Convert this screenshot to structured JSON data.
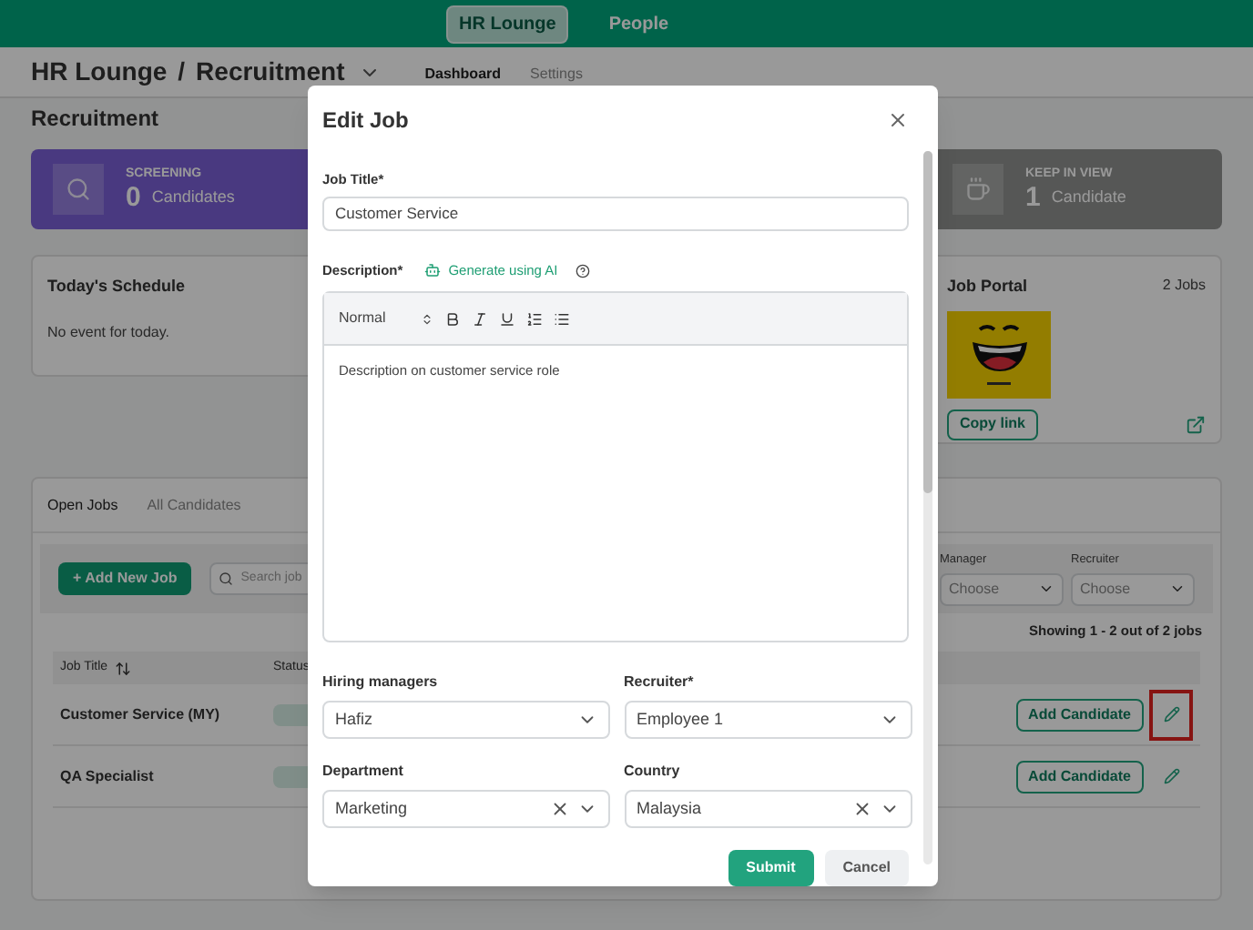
{
  "top_nav": [
    {
      "label": "HR Lounge",
      "selected": true
    },
    {
      "label": "People",
      "selected": false
    }
  ],
  "breadcrumb": {
    "parent": "HR Lounge",
    "separator": "/",
    "current": "Recruitment"
  },
  "page_tabs": [
    {
      "label": "Dashboard",
      "selected": true
    },
    {
      "label": "Settings",
      "selected": false
    }
  ],
  "page_title": "Recruitment",
  "stat_cards": [
    {
      "kind": "screening",
      "label": "SCREENING",
      "count": "0",
      "unit": "Candidates"
    },
    {
      "kind": "keep",
      "label": "KEEP IN VIEW",
      "count": "1",
      "unit": "Candidate"
    }
  ],
  "schedule": {
    "title": "Today's Schedule",
    "message": "No event for today."
  },
  "job_portal": {
    "title": "Job Portal",
    "count": "2 Jobs",
    "button": "Copy link"
  },
  "jobs_panel": {
    "tabs": [
      {
        "label": "Open Jobs",
        "selected": true
      },
      {
        "label": "All Candidates",
        "selected": false
      }
    ],
    "add_button": "+ Add New Job",
    "search": {
      "placeholder": "Search job"
    },
    "filters": [
      {
        "label": "Manager",
        "placeholder": "Choose"
      },
      {
        "label": "Recruiter",
        "placeholder": "Choose"
      }
    ],
    "summary": "Showing 1 - 2 out of 2 jobs",
    "columns": [
      {
        "label": "Job Title",
        "sortable": true
      },
      {
        "label": "Status",
        "sortable": false
      }
    ],
    "rows": [
      {
        "title": "Customer Service (MY)",
        "action": "Add Candidate",
        "highlighted": true
      },
      {
        "title": "QA Specialist",
        "action": "Add Candidate",
        "highlighted": false
      }
    ]
  },
  "modal": {
    "title": "Edit Job",
    "job_title": {
      "label": "Job Title*",
      "value": "Customer Service"
    },
    "description": {
      "label": "Description*",
      "ai_link": "Generate using AI",
      "style": "Normal",
      "content": "Description on customer service role"
    },
    "selects": [
      {
        "label": "Hiring managers",
        "value": "Hafiz",
        "clearable": false
      },
      {
        "label": "Recruiter*",
        "value": "Employee 1",
        "clearable": false
      },
      {
        "label": "Department",
        "value": "Marketing",
        "clearable": true
      },
      {
        "label": "Country",
        "value": "Malaysia",
        "clearable": true
      }
    ],
    "buttons": [
      {
        "label": "Submit",
        "kind": "primary"
      },
      {
        "label": "Cancel",
        "kind": "secondary"
      }
    ]
  }
}
